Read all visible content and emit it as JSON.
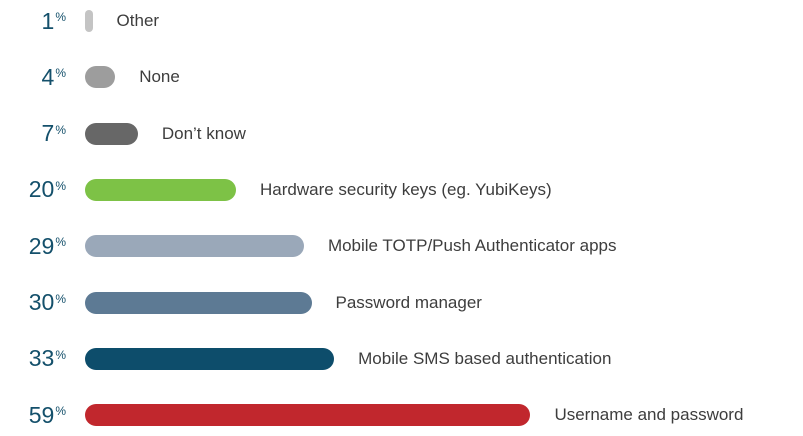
{
  "chart_data": {
    "type": "bar",
    "orientation": "horizontal",
    "title": "",
    "xlabel": "",
    "ylabel": "",
    "unit": "%",
    "categories": [
      "Other",
      "None",
      "Don’t know",
      "Hardware security keys (eg. YubiKeys)",
      "Mobile TOTP/Push Authenticator apps",
      "Password manager",
      "Mobile SMS based authentication",
      "Username and password"
    ],
    "values": [
      1,
      4,
      7,
      20,
      29,
      30,
      33,
      59
    ],
    "colors": [
      "#c4c4c4",
      "#9d9d9d",
      "#676767",
      "#7dc246",
      "#9aa8b9",
      "#5d7a94",
      "#0d4d6b",
      "#c1272d"
    ],
    "percent_color": "#14506b",
    "label_color": "#3d3d3d",
    "grid": false,
    "legend": "none"
  }
}
